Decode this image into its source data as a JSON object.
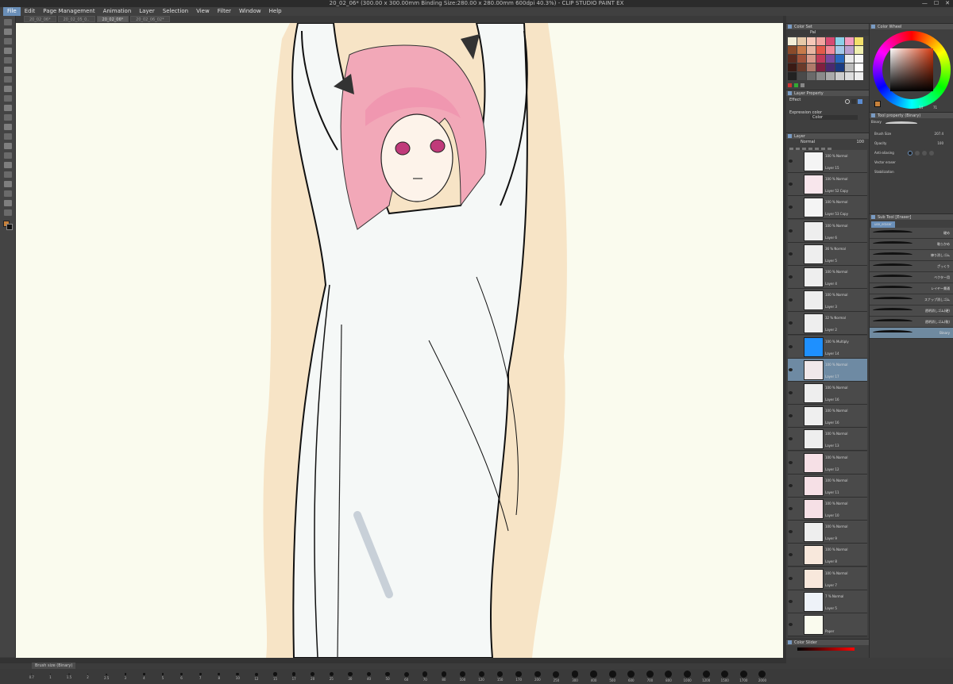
{
  "title_bar": {
    "text": "20_02_06* (300.00 x 300.00mm Binding Size:280.00 x 280.00mm 600dpi 40.3%) - CLIP STUDIO PAINT EX"
  },
  "menu": [
    "File",
    "Edit",
    "Page Management",
    "Animation",
    "Layer",
    "Selection",
    "View",
    "Filter",
    "Window",
    "Help"
  ],
  "doc_tabs": [
    "20_02_06*",
    "20_02_05_0..",
    "20_02_06*",
    "20_02_06_02*"
  ],
  "brush_bar_tab": "Brush size (Binary)",
  "brush_sizes": [
    "0.7",
    "1",
    "1.5",
    "2",
    "2.5",
    "3",
    "4",
    "5",
    "6",
    "7",
    "8",
    "10",
    "12",
    "15",
    "17",
    "20",
    "25",
    "30",
    "40",
    "50",
    "60",
    "70",
    "80",
    "100",
    "120",
    "150",
    "170",
    "200",
    "250",
    "300",
    "400",
    "500",
    "600",
    "700",
    "800",
    "1000",
    "1200",
    "1500",
    "1700",
    "2000"
  ],
  "color_set": {
    "title": "Color Set",
    "dropdown": "Pal",
    "colors": [
      "#f3eed8",
      "#e6c9a8",
      "#f7c8b8",
      "#f2a6a0",
      "#d64a72",
      "#8bd0e8",
      "#f29cc0",
      "#f3e06a",
      "#8a4a2a",
      "#c77a4a",
      "#e8b6a2",
      "#e35a4a",
      "#f28a9a",
      "#a4c8e8",
      "#b8a0d0",
      "#f0f0b0",
      "#5a2a1e",
      "#a0523a",
      "#d89a8a",
      "#c03a5a",
      "#7a4aa0",
      "#2a6ac0",
      "#e8e8e8",
      "#f8f8f8",
      "#3a1a14",
      "#6a3a2a",
      "#b07a6a",
      "#802040",
      "#4a2a70",
      "#1a3a80",
      "#bcbcbc",
      "#ffffff",
      "#222222",
      "#4a4a4a",
      "#6a6a6a",
      "#8a8a8a",
      "#aaaaaa",
      "#cccccc",
      "#dddddd",
      "#eeeeee"
    ]
  },
  "layer_property": {
    "title": "Layer Property",
    "effect": "Effect",
    "expression_label": "Expression color",
    "expression_value": "Color"
  },
  "layer_panel": {
    "title": "Layer",
    "blend": "Normal",
    "opacity": "100",
    "layers": [
      {
        "mode": "100 % Normal",
        "name": "Layer 15",
        "thumb": "glasses"
      },
      {
        "mode": "100 % Normal",
        "name": "Layer 52 Copy",
        "thumb": "hearts"
      },
      {
        "mode": "100 % Normal",
        "name": "Layer 53 Copy",
        "thumb": "dots"
      },
      {
        "mode": "100 % Normal",
        "name": "Layer 6",
        "thumb": "blank"
      },
      {
        "mode": "36 % Normal",
        "name": "Layer 5",
        "thumb": "blank"
      },
      {
        "mode": "100 % Normal",
        "name": "Layer 4",
        "thumb": "blank"
      },
      {
        "mode": "100 % Normal",
        "name": "Layer 3",
        "thumb": "blank"
      },
      {
        "mode": "32 % Normal",
        "name": "Layer 2",
        "thumb": "blank"
      },
      {
        "mode": "100 % Multiply",
        "name": "Layer 14",
        "thumb": "blue"
      },
      {
        "mode": "100 % Normal",
        "name": "Layer 17",
        "thumb": "sel"
      },
      {
        "mode": "100 % Normal",
        "name": "Layer 16",
        "thumb": "blank"
      },
      {
        "mode": "100 % Normal",
        "name": "Layer 16",
        "thumb": "sketch"
      },
      {
        "mode": "100 % Normal",
        "name": "Layer 13",
        "thumb": "blank"
      },
      {
        "mode": "100 % Normal",
        "name": "Layer 12",
        "thumb": "pink"
      },
      {
        "mode": "100 % Normal",
        "name": "Layer 11",
        "thumb": "pink"
      },
      {
        "mode": "100 % Normal",
        "name": "Layer 10",
        "thumb": "pink"
      },
      {
        "mode": "100 % Normal",
        "name": "Layer 9",
        "thumb": "blank"
      },
      {
        "mode": "100 % Normal",
        "name": "Layer 8",
        "thumb": "skin"
      },
      {
        "mode": "100 % Normal",
        "name": "Layer 7",
        "thumb": "skin"
      },
      {
        "mode": "7 % Normal",
        "name": "Layer 5",
        "thumb": "blue-sketch"
      },
      {
        "mode": "",
        "name": "Paper",
        "thumb": "paper"
      }
    ]
  },
  "color_slider": {
    "title": "Color Slider"
  },
  "color_wheel": {
    "title": "Color Wheel",
    "value_a": "14",
    "value_b": "71"
  },
  "tool_property": {
    "title": "Tool property (Binary)",
    "tool_name": "Binary",
    "brush_size_label": "Brush Size",
    "brush_size_value": "207.4",
    "opacity_label": "Opacity",
    "opacity_value": "100",
    "antialias_label": "Anti-aliasing",
    "vector_eraser_label": "Vector eraser",
    "stabilization_label": "Stabilization"
  },
  "sub_tool": {
    "title": "Sub Tool [Eraser]",
    "tab": "use_eraser",
    "items": [
      "硬め",
      "軟らかめ",
      "練り消しゴム",
      "ざっくり",
      "ベクター用",
      "レイヤー貫通",
      "スナップ消しゴム",
      "透明消しゴム(硬)",
      "透明消しゴム(軟)",
      "Binary"
    ]
  }
}
